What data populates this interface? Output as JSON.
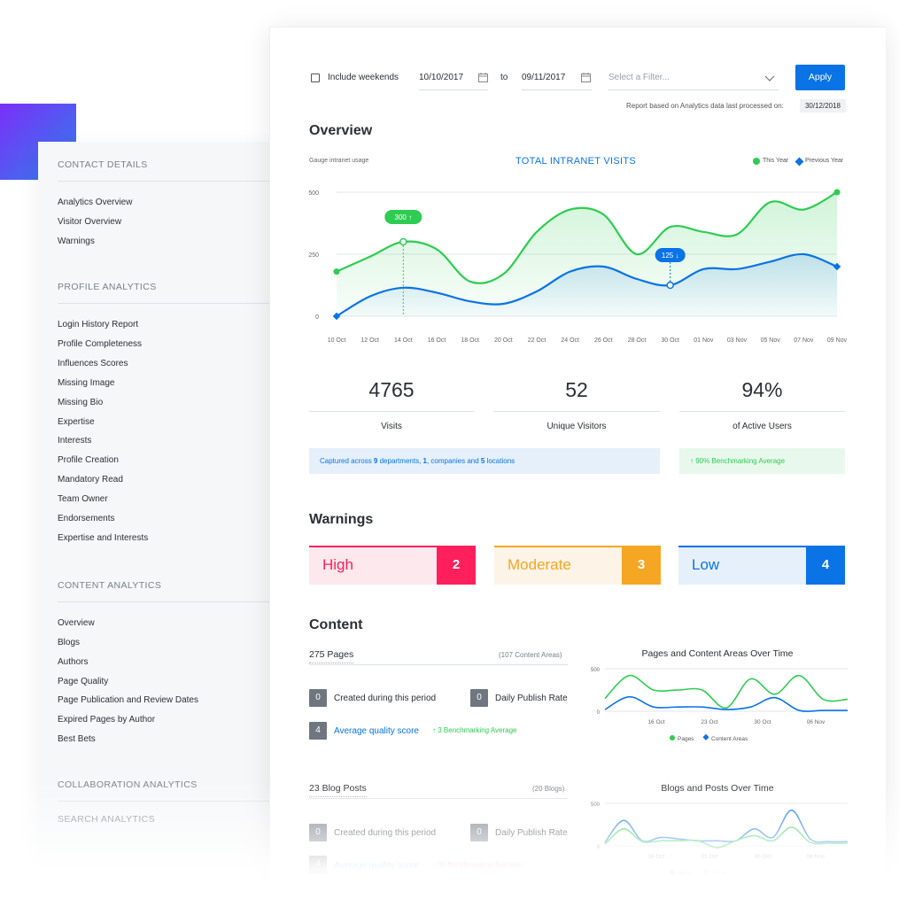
{
  "sidebar": {
    "sections": [
      {
        "title": "CONTACT DETAILS",
        "items": [
          "Analytics Overview",
          "Visitor Overview",
          "Warnings"
        ]
      },
      {
        "title": "PROFILE ANALYTICS",
        "items": [
          "Login History Report",
          "Profile Completeness",
          "Influences Scores",
          "Missing Image",
          "Missing Bio",
          "Expertise",
          "Interests",
          "Profile Creation",
          "Mandatory Read",
          "Team Owner",
          "Endorsements",
          "Expertise and Interests"
        ]
      },
      {
        "title": "CONTENT ANALYTICS",
        "items": [
          "Overview",
          "Blogs",
          "Authors",
          "Page Quality",
          "Page Publication and Review Dates",
          "Expired Pages by Author",
          "Best Bets"
        ]
      },
      {
        "title": "COLLABORATION ANALYTICS",
        "items": []
      },
      {
        "title": "SEARCH ANALYTICS",
        "items": []
      }
    ]
  },
  "filters": {
    "weekends_label": "Include weekends",
    "date_from": "10/10/2017",
    "to_label": "to",
    "date_to": "09/11/2017",
    "filter_placeholder": "Select a Filter...",
    "apply_label": "Apply",
    "report_note": "Report based on Analytics data last processed on:",
    "report_date": "30/12/2018"
  },
  "overview": {
    "title": "Overview",
    "gauge_label": "Gauge intranet usage",
    "chart_title": "TOTAL INTRANET VISITS",
    "legend_this": "This Year",
    "legend_prev": "Previous Year",
    "callout_high": "300",
    "callout_low": "125",
    "stats": [
      {
        "value": "4765",
        "label": "Visits"
      },
      {
        "value": "52",
        "label": "Unique Visitors"
      },
      {
        "value": "94%",
        "label": "of Active Users"
      }
    ],
    "captured": {
      "prefix": "Captured across ",
      "dept_count": "9",
      "dept_label": " departments, ",
      "company_count": "1",
      "company_label": ", companies and ",
      "loc_count": "5",
      "loc_label": " locations"
    },
    "benchmark": "90% Benchmarking Average"
  },
  "warnings": {
    "title": "Warnings",
    "items": [
      {
        "label": "High",
        "count": "2",
        "color": "#ff1f5a",
        "bg": "#fde8ee"
      },
      {
        "label": "Moderate",
        "count": "3",
        "color": "#f5a623",
        "bg": "#fdf3e6"
      },
      {
        "label": "Low",
        "count": "4",
        "color": "#0a73e6",
        "bg": "#e6f0fb"
      }
    ]
  },
  "content": {
    "title": "Content",
    "pages": {
      "count_label": "275 Pages",
      "areas": "(107 Content Areas)",
      "created_value": "0",
      "created_label": "Created during this period",
      "publish_value": "0",
      "publish_label": "Daily Publish Rate",
      "quality_value": "4",
      "quality_label": "Average quality score",
      "bench": "3 Benchmarking Average"
    },
    "blogs": {
      "count_label": "23 Blog Posts",
      "sub": "(20 Blogs)",
      "created_value": "0",
      "created_label": "Created during this period",
      "publish_value": "0",
      "publish_label": "Daily Publish Rate",
      "quality_value": "4",
      "quality_label": "Average quality score",
      "bench": "30 Benchmarking Average"
    },
    "pages_chart_title": "Pages and Content Areas Over Time",
    "blogs_chart_title": "Blogs and Posts Over Time",
    "pages_legend": [
      "Pages",
      "Content Areas"
    ],
    "blogs_legend": [
      "Blogs",
      "Posts"
    ]
  },
  "chart_data": [
    {
      "type": "area",
      "title": "TOTAL INTRANET VISITS",
      "categories": [
        "10 Oct",
        "12 Oct",
        "14 Oct",
        "16 Oct",
        "18 Oct",
        "20 Oct",
        "22 Oct",
        "24 Oct",
        "26 Oct",
        "28 Oct",
        "30 Oct",
        "01 Nov",
        "03 Nov",
        "05 Nov",
        "07 Nov",
        "09 Nov"
      ],
      "yticks": [
        0,
        250,
        500
      ],
      "ylim": [
        0,
        500
      ],
      "legend_position": "top-right",
      "grid": true,
      "series": [
        {
          "name": "This Year",
          "color": "#2ecc52",
          "values": [
            180,
            240,
            300,
            270,
            140,
            170,
            340,
            430,
            410,
            250,
            360,
            340,
            330,
            460,
            430,
            500
          ]
        },
        {
          "name": "Previous Year",
          "color": "#0a73e6",
          "values": [
            0,
            80,
            115,
            95,
            60,
            50,
            100,
            180,
            200,
            150,
            125,
            190,
            190,
            220,
            250,
            200
          ]
        }
      ]
    },
    {
      "type": "line",
      "title": "Pages and Content Areas Over Time",
      "categories": [
        "16 Oct",
        "23 Oct",
        "30 Oct",
        "06 Nov"
      ],
      "yticks": [
        0,
        500
      ],
      "series": [
        {
          "name": "Pages",
          "color": "#2ecc52",
          "values": [
            150,
            420,
            250,
            250,
            250,
            40,
            380,
            200,
            420,
            140,
            140
          ]
        },
        {
          "name": "Content Areas",
          "color": "#0a73e6",
          "values": [
            20,
            170,
            50,
            50,
            50,
            20,
            50,
            160,
            10,
            10,
            10
          ]
        }
      ]
    },
    {
      "type": "line",
      "title": "Blogs and Posts Over Time",
      "categories": [
        "16 Oct",
        "23 Oct",
        "30 Oct",
        "06 Nov"
      ],
      "yticks": [
        0,
        500
      ],
      "series": [
        {
          "name": "Blogs",
          "color": "#0a73e6",
          "values": [
            40,
            300,
            60,
            100,
            80,
            60,
            60,
            60,
            200,
            100,
            420,
            80,
            50,
            50
          ]
        },
        {
          "name": "Posts",
          "color": "#2ecc52",
          "values": [
            20,
            200,
            50,
            60,
            60,
            60,
            -20,
            60,
            120,
            60,
            220,
            40,
            30,
            30
          ]
        }
      ]
    }
  ]
}
